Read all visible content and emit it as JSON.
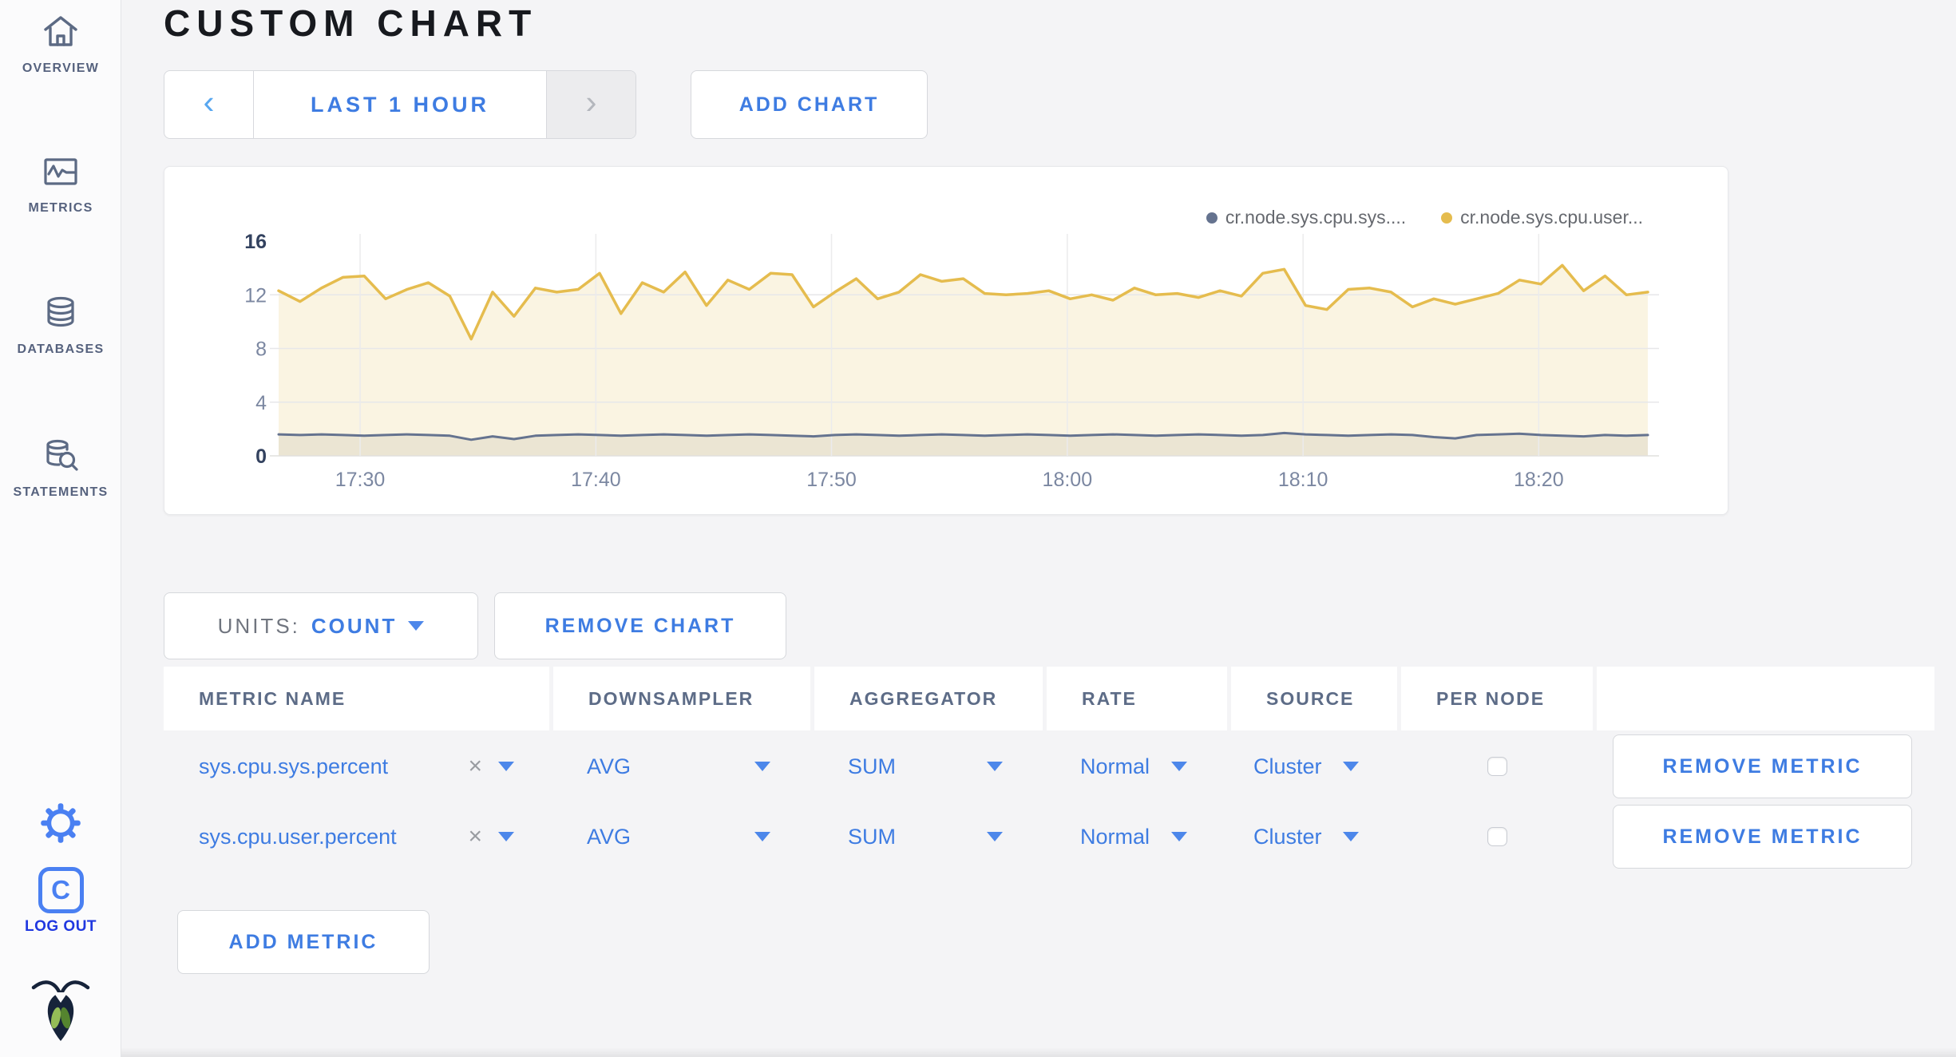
{
  "sidebar": {
    "items": [
      {
        "label": "OVERVIEW"
      },
      {
        "label": "METRICS"
      },
      {
        "label": "DATABASES"
      },
      {
        "label": "STATEMENTS"
      }
    ],
    "logout_label": "LOG OUT"
  },
  "header": {
    "title": "CUSTOM CHART"
  },
  "time_window": {
    "label": "LAST 1 HOUR",
    "prev_glyph": "‹",
    "next_glyph": "›"
  },
  "toolbar": {
    "add_chart_label": "ADD CHART"
  },
  "units_bar": {
    "units_label": "UNITS:",
    "units_value": "COUNT",
    "remove_chart_label": "REMOVE CHART"
  },
  "chart_data": {
    "type": "area",
    "title": "",
    "units": "count",
    "ylim": [
      0,
      16
    ],
    "yticks": [
      0,
      4,
      8,
      12,
      16
    ],
    "xticks": [
      "17:30",
      "17:40",
      "17:50",
      "18:00",
      "18:10",
      "18:20"
    ],
    "xtick_fractions": [
      0.0595,
      0.2317,
      0.4038,
      0.576,
      0.7482,
      0.9203
    ],
    "grid": true,
    "legend_position": "top-right",
    "series": [
      {
        "name": "cr.node.sys.cpu.sys....",
        "color": "#65738f",
        "fill": "rgba(70,62,42,0.08)",
        "width": 3,
        "values": [
          1.6,
          1.55,
          1.6,
          1.55,
          1.5,
          1.55,
          1.6,
          1.55,
          1.5,
          1.2,
          1.45,
          1.25,
          1.5,
          1.55,
          1.6,
          1.55,
          1.5,
          1.55,
          1.6,
          1.55,
          1.5,
          1.55,
          1.6,
          1.55,
          1.5,
          1.45,
          1.55,
          1.6,
          1.55,
          1.5,
          1.55,
          1.6,
          1.55,
          1.5,
          1.55,
          1.6,
          1.55,
          1.5,
          1.55,
          1.6,
          1.55,
          1.5,
          1.55,
          1.6,
          1.55,
          1.5,
          1.55,
          1.7,
          1.6,
          1.55,
          1.5,
          1.55,
          1.6,
          1.55,
          1.4,
          1.3,
          1.55,
          1.6,
          1.65,
          1.55,
          1.5,
          1.45,
          1.55,
          1.5,
          1.55
        ]
      },
      {
        "name": "cr.node.sys.cpu.user...",
        "color": "#e5bc4e",
        "fill": "#faf4e2",
        "width": 3.5,
        "values": [
          12.3,
          11.5,
          12.5,
          13.3,
          13.4,
          11.7,
          12.4,
          12.9,
          11.9,
          8.7,
          12.2,
          10.4,
          12.5,
          12.2,
          12.4,
          13.6,
          10.6,
          12.9,
          12.2,
          13.7,
          11.2,
          13.1,
          12.4,
          13.6,
          13.5,
          11.1,
          12.2,
          13.2,
          11.7,
          12.2,
          13.5,
          13.0,
          13.2,
          12.1,
          12.0,
          12.1,
          12.3,
          11.7,
          12.0,
          11.6,
          12.5,
          12.0,
          12.1,
          11.8,
          12.3,
          11.9,
          13.6,
          13.9,
          11.2,
          10.9,
          12.4,
          12.5,
          12.2,
          11.1,
          11.7,
          11.3,
          11.7,
          12.1,
          13.1,
          12.8,
          14.2,
          12.3,
          13.4,
          12.0,
          12.2
        ]
      }
    ]
  },
  "metrics_table": {
    "headers": [
      "METRIC NAME",
      "DOWNSAMPLER",
      "AGGREGATOR",
      "RATE",
      "SOURCE",
      "PER NODE",
      ""
    ],
    "clear_glyph": "×",
    "rows": [
      {
        "metric_name": "sys.cpu.sys.percent",
        "downsampler": "AVG",
        "aggregator": "SUM",
        "rate": "Normal",
        "source": "Cluster",
        "per_node_checked": false,
        "remove_label": "REMOVE METRIC"
      },
      {
        "metric_name": "sys.cpu.user.percent",
        "downsampler": "AVG",
        "aggregator": "SUM",
        "rate": "Normal",
        "source": "Cluster",
        "per_node_checked": false,
        "remove_label": "REMOVE METRIC"
      }
    ],
    "add_metric_label": "ADD METRIC"
  },
  "colors": {
    "accent_blue": "#3e7ce2",
    "icon_blue": "#4a80f2",
    "logout_blue": "#2038e0",
    "sidebar_slate": "#56627e",
    "series_yellow": "#e5bc4e",
    "series_slate": "#65738f",
    "page_bg": "#f4f4f6"
  }
}
